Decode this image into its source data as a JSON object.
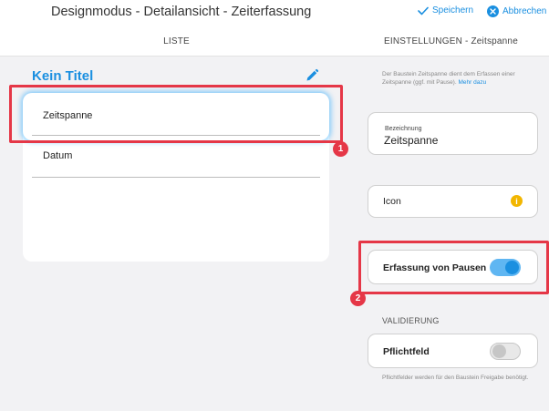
{
  "header": {
    "title": "Designmodus - Detailansicht - Zeiterfassung",
    "save_label": "Speichern",
    "cancel_label": "Abbrechen"
  },
  "subheader": {
    "left": "LISTE",
    "right": "EINSTELLUNGEN - Zeitspanne"
  },
  "list": {
    "form_title": "Kein Titel",
    "fields": [
      {
        "label": "Zeitspanne",
        "selected": true
      },
      {
        "label": "Datum",
        "selected": false
      }
    ]
  },
  "settings": {
    "help_text": "Der Baustein Zeitspanne dient dem Erfassen einer Zeitspanne (ggf. mit Pause).",
    "help_link": "Mehr dazu",
    "bezeichnung_label": "Bezeichnung",
    "bezeichnung_value": "Zeitspanne",
    "icon_label": "Icon",
    "pausen_label": "Erfassung von Pausen",
    "pausen_on": true,
    "validierung_label": "VALIDIERUNG",
    "pflichtfeld_label": "Pflichtfeld",
    "pflichtfeld_on": false,
    "footer_text": "Pflichtfelder werden für den Baustein Freigabe benötigt."
  },
  "annotations": {
    "badge_1": "1",
    "badge_2": "2"
  },
  "colors": {
    "accent": "#1a8fe0",
    "highlight": "#e53747",
    "info": "#f2b600"
  }
}
